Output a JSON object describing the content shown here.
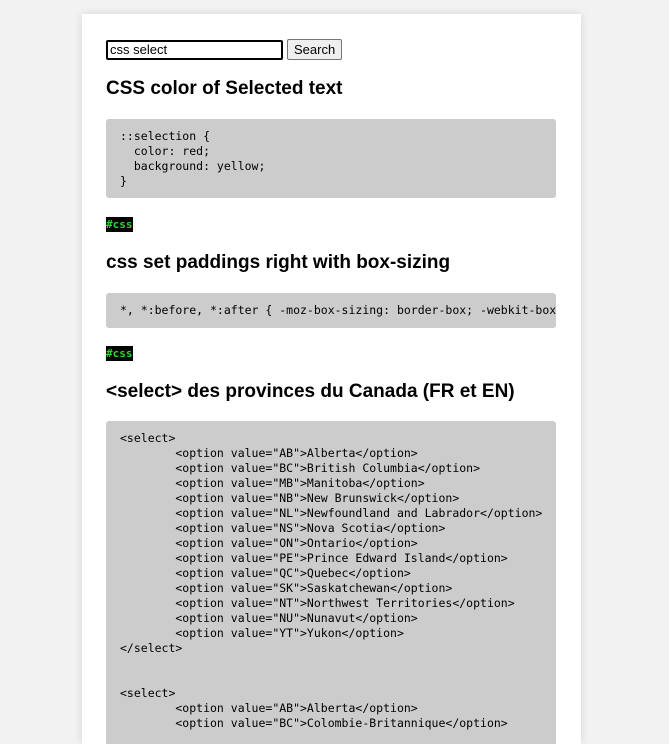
{
  "search": {
    "value": "css select",
    "button_label": "Search"
  },
  "posts": [
    {
      "title": "CSS color of Selected text",
      "code": "::selection {\n  color: red;\n  background: yellow;\n}",
      "tag": "#css"
    },
    {
      "title": "css set paddings right with box-sizing",
      "code": "*, *:before, *:after { -moz-box-sizing: border-box; -webkit-box-sizing: border-box; box-sizing: border-box; }",
      "tag": "#css"
    },
    {
      "title": "<select> des provinces du Canada (FR et EN)",
      "code": "<select>\n        <option value=\"AB\">Alberta</option>\n        <option value=\"BC\">British Columbia</option>\n        <option value=\"MB\">Manitoba</option>\n        <option value=\"NB\">New Brunswick</option>\n        <option value=\"NL\">Newfoundland and Labrador</option>\n        <option value=\"NS\">Nova Scotia</option>\n        <option value=\"ON\">Ontario</option>\n        <option value=\"PE\">Prince Edward Island</option>\n        <option value=\"QC\">Quebec</option>\n        <option value=\"SK\">Saskatchewan</option>\n        <option value=\"NT\">Northwest Territories</option>\n        <option value=\"NU\">Nunavut</option>\n        <option value=\"YT\">Yukon</option>\n</select>\n\n\n<select>\n        <option value=\"AB\">Alberta</option>\n        <option value=\"BC\">Colombie-Britannique</option>"
    }
  ]
}
